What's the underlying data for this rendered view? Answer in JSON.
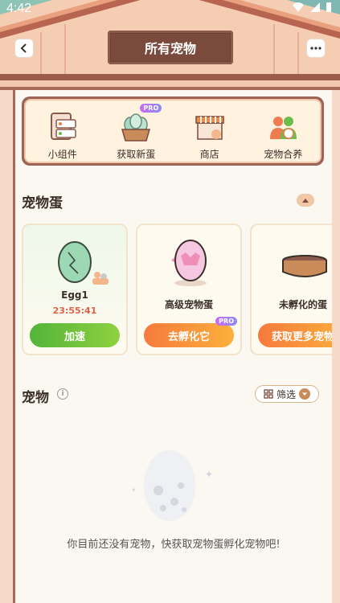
{
  "status_bar": {
    "time": "4:42"
  },
  "header": {
    "title": "所有宠物"
  },
  "actions": [
    {
      "label": "小组件",
      "icon": "widget-icon",
      "pro": ""
    },
    {
      "label": "获取新蛋",
      "icon": "egg-basket-icon",
      "pro": "PRO"
    },
    {
      "label": "商店",
      "icon": "shop-icon",
      "pro": ""
    },
    {
      "label": "宠物合养",
      "icon": "pet-co-raise-icon",
      "pro": ""
    }
  ],
  "eggs_section": {
    "title": "宠物蛋",
    "cards": [
      {
        "name": "Egg1",
        "timer": "23:55:41",
        "button": "加速",
        "pro": ""
      },
      {
        "name": "高级宠物蛋",
        "timer": "",
        "button": "去孵化它",
        "pro": "PRO"
      },
      {
        "name": "未孵化的蛋",
        "timer": "",
        "button": "获取更多宠物",
        "pro": ""
      }
    ]
  },
  "pets_section": {
    "title": "宠物",
    "filter_label": "筛选",
    "empty_message": "你目前还没有宠物，快获取宠物蛋孵化宠物吧!"
  },
  "colors": {
    "accent_green": "#53b43a",
    "accent_orange": "#f77a3c",
    "frame_brown": "#7a4a3d"
  }
}
